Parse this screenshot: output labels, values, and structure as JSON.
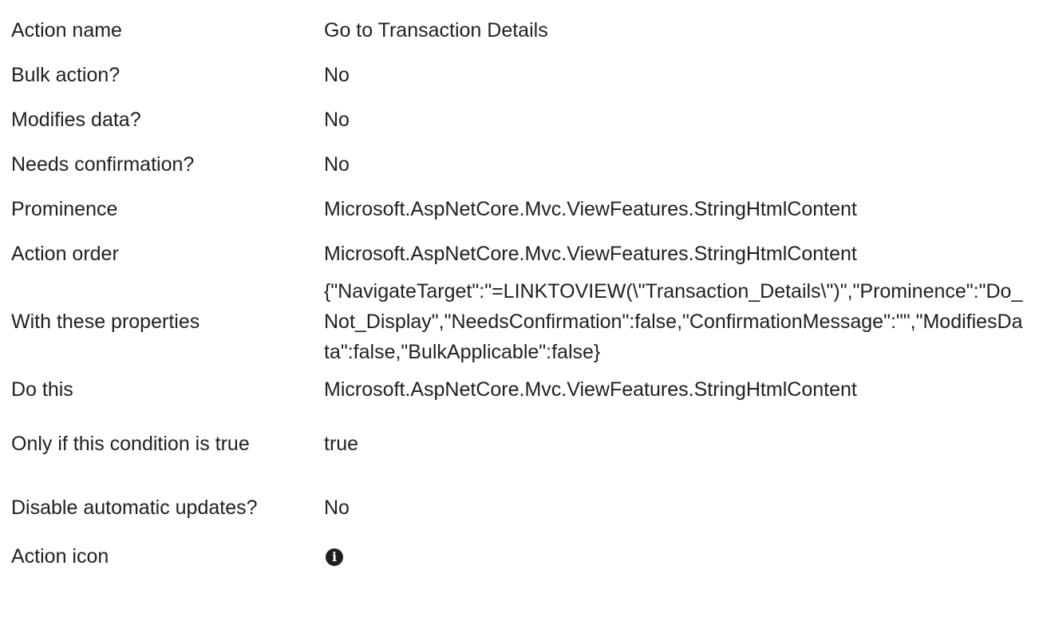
{
  "properties": [
    {
      "label": "Action name",
      "value": "Go to Transaction Details"
    },
    {
      "label": "Bulk action?",
      "value": "No"
    },
    {
      "label": "Modifies data?",
      "value": "No"
    },
    {
      "label": "Needs confirmation?",
      "value": "No"
    },
    {
      "label": "Prominence",
      "value": "Microsoft.AspNetCore.Mvc.ViewFeatures.StringHtmlContent"
    },
    {
      "label": "Action order",
      "value": "Microsoft.AspNetCore.Mvc.ViewFeatures.StringHtmlContent"
    },
    {
      "label": "With these properties",
      "value": "{\"NavigateTarget\":\"=LINKTOVIEW(\\\"Transaction_Details\\\")\",\"Prominence\":\"Do_Not_Display\",\"NeedsConfirmation\":false,\"ConfirmationMessage\":\"\",\"ModifiesData\":false,\"BulkApplicable\":false}"
    },
    {
      "label": "Do this",
      "value": "Microsoft.AspNetCore.Mvc.ViewFeatures.StringHtmlContent"
    },
    {
      "label": "Only if this condition is true",
      "value": "true"
    },
    {
      "label": "Disable automatic updates?",
      "value": "No"
    },
    {
      "label": "Action icon",
      "icon": "info-circle-icon",
      "glyph": "i"
    }
  ]
}
